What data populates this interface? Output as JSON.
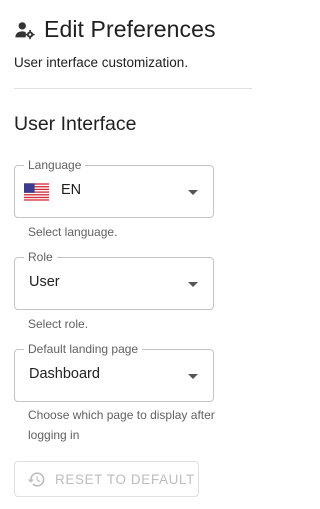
{
  "header": {
    "icon": "user-settings-icon",
    "title": "Edit Preferences",
    "subtitle": "User interface customization."
  },
  "section": {
    "title": "User Interface"
  },
  "fields": {
    "language": {
      "legend": "Language",
      "value": "EN",
      "flag_icon": "us-flag-icon",
      "helper": "Select language."
    },
    "role": {
      "legend": "Role",
      "value": "User",
      "helper": "Select role."
    },
    "landing": {
      "legend": "Default landing page",
      "value": "Dashboard",
      "helper": "Choose which page to display after logging in"
    }
  },
  "reset_button": {
    "label": "RESET TO DEFAULT",
    "icon": "history-icon",
    "disabled": true
  },
  "colors": {
    "text": "#212121",
    "helper": "#616161",
    "border": "#c4c4c4",
    "disabled": "#bdbdbd"
  }
}
